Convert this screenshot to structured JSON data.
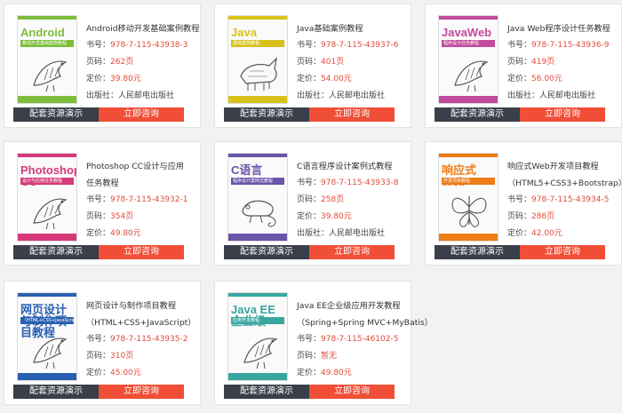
{
  "labels": {
    "isbn_prefix": "书号：",
    "pages_prefix": "页码：",
    "price_prefix": "定价：",
    "publisher_prefix": "出版社：",
    "resource_button": "配套资源演示",
    "consult_button": "立即咨询"
  },
  "books": [
    {
      "title_lines": [
        "Android移动开发基础案例教程"
      ],
      "isbn": "978-7-115-43938-3",
      "pages": "262页",
      "price": "39.80元",
      "publisher": "人民邮电出版社",
      "cover_title": "Android",
      "cover_subtitle": "移动开发基础案例教程",
      "cover_color": "#7cbd3a",
      "cover_icon": "bird-icon"
    },
    {
      "title_lines": [
        "Java基础案例教程"
      ],
      "isbn": "978-7-115-43937-6",
      "pages": "401页",
      "price": "54.00元",
      "publisher": "人民邮电出版社",
      "cover_title": "Java",
      "cover_subtitle": "基础案例教程",
      "cover_color": "#d8c21a",
      "cover_icon": "rhino-icon"
    },
    {
      "title_lines": [
        "Java Web程序设计任务教程"
      ],
      "isbn": "978-7-115-43936-9",
      "pages": "419页",
      "price": "56.00元",
      "publisher": "人民邮电出版社",
      "cover_title": "JavaWeb",
      "cover_subtitle": "程序设计任务教程",
      "cover_color": "#c24a9c",
      "cover_icon": "bird-icon"
    },
    {
      "title_lines": [
        "Photoshop CC设计与应用",
        "任务教程"
      ],
      "isbn": "978-7-115-43932-1",
      "pages": "354页",
      "price": "49.80元",
      "publisher": "人民邮电出版社",
      "cover_title": "Photoshop CC",
      "cover_subtitle": "设计与应用任务教程",
      "cover_color": "#d63a7a",
      "cover_icon": "bird-icon"
    },
    {
      "title_lines": [
        "C语言程序设计案例式教程"
      ],
      "isbn": "978-7-115-43933-8",
      "pages": "258页",
      "price": "39.80元",
      "publisher": "人民邮电出版社",
      "cover_title": "C语言",
      "cover_subtitle": "程序设计案例式教程",
      "cover_color": "#6a55a8",
      "cover_icon": "chameleon-icon"
    },
    {
      "title_lines": [
        "响应式Web开发项目教程",
        "（HTML5+CSS3+Bootstrap）"
      ],
      "isbn": "978-7-115-43934-5",
      "pages": "286页",
      "price": "42.00元",
      "publisher": "人民邮电出版社",
      "cover_title": "响应式Web",
      "cover_subtitle": "开发项目教程",
      "cover_color": "#ef7d18",
      "cover_icon": "butterfly-icon"
    },
    {
      "title_lines": [
        "网页设计与制作项目教程",
        "（HTML+CSS+JavaScript）"
      ],
      "isbn": "978-7-115-43935-2",
      "pages": "310页",
      "price": "45.00元",
      "publisher": "人民邮电出版社",
      "cover_title": "网页设计与制作项目教程",
      "cover_subtitle": "（HTML+CSS+JavaScript）",
      "cover_color": "#2a5fb0",
      "cover_icon": "bird-icon"
    },
    {
      "title_lines": [
        "Java EE企业级应用开发教程",
        "（Spring+Spring MVC+MyBatis）"
      ],
      "isbn": "978-7-115-46102-5",
      "pages": "暂无",
      "price": "49.80元",
      "publisher": "人民邮电出版社",
      "cover_title": "Java EE企业级",
      "cover_subtitle": "应用开发教程",
      "cover_color": "#3aa6a0",
      "cover_icon": "bird-icon"
    }
  ]
}
